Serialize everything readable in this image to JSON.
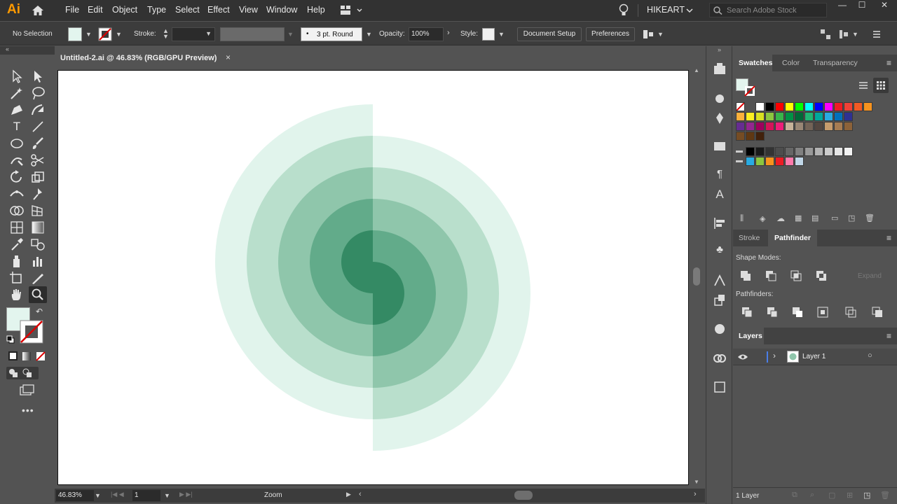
{
  "app": {
    "logo": "Ai",
    "menu": [
      "File",
      "Edit",
      "Object",
      "Type",
      "Select",
      "Effect",
      "View",
      "Window",
      "Help"
    ],
    "workspace": "HIKEART",
    "search_placeholder": "Search Adobe Stock",
    "window_controls": [
      "—",
      "☐",
      "✕"
    ]
  },
  "control_bar": {
    "selection": "No Selection",
    "stroke_label": "Stroke:",
    "brush_value": "3 pt. Round",
    "brush_dot": "•",
    "opacity_label": "Opacity:",
    "opacity_value": "100%",
    "style_label": "Style:",
    "document_setup": "Document Setup",
    "preferences": "Preferences"
  },
  "document": {
    "tab_title": "Untitled-2.ai @ 46.83% (RGB/GPU Preview)",
    "close": "×",
    "zoom": "46.83%",
    "artboard_number": "1",
    "status_label": "Zoom"
  },
  "panels": {
    "swatches_tabs": [
      "Swatches",
      "Color",
      "Transparency"
    ],
    "stroke_tabs": [
      "Stroke",
      "Pathfinder"
    ],
    "shape_modes_label": "Shape Modes:",
    "pathfinders_label": "Pathfinders:",
    "expand": "Expand",
    "layers_tab": "Layers",
    "layer_name": "Layer 1",
    "layer_count": "1 Layer"
  },
  "colors": {
    "fill": "#e3f5ee",
    "ring1": "#e1f4ec",
    "ring2": "#b9dfcc",
    "ring3": "#8fc6ab",
    "ring4": "#62ab8a",
    "ring5": "#348a64",
    "accent": "#ff9a00",
    "swatch_rows": [
      [
        "#ffffff",
        "#000000",
        "#ff0000",
        "#ffff00",
        "#00ff00",
        "#00ffff",
        "#0000ff",
        "#ff00ff",
        "#ed1c24",
        "#ef4136",
        "#f15a24",
        "#f7931e"
      ],
      [
        "#fbb03b",
        "#fcee21",
        "#d9e021",
        "#8cc63f",
        "#39b54a",
        "#009245",
        "#006837",
        "#22b573",
        "#00a99d",
        "#29abe2",
        "#0071bc",
        "#2e3192"
      ],
      [
        "#662d91",
        "#93278f",
        "#9e005d",
        "#d4145a",
        "#ed1e79",
        "#c7b299",
        "#998675",
        "#736357",
        "#534741",
        "#c69c6d",
        "#a67c52",
        "#8c6239"
      ],
      [
        "#754c24",
        "#603813",
        "#42210b"
      ],
      [
        "#000000",
        "#1a1a1a",
        "#333333",
        "#4d4d4d",
        "#666666",
        "#808080",
        "#999999",
        "#b3b3b3",
        "#cccccc",
        "#e6e6e6",
        "#f2f2f2"
      ],
      [
        "#29abe2",
        "#8cc63f",
        "#f7931e",
        "#ed1c24",
        "#ff7bac",
        "#c1d7e8"
      ]
    ]
  }
}
